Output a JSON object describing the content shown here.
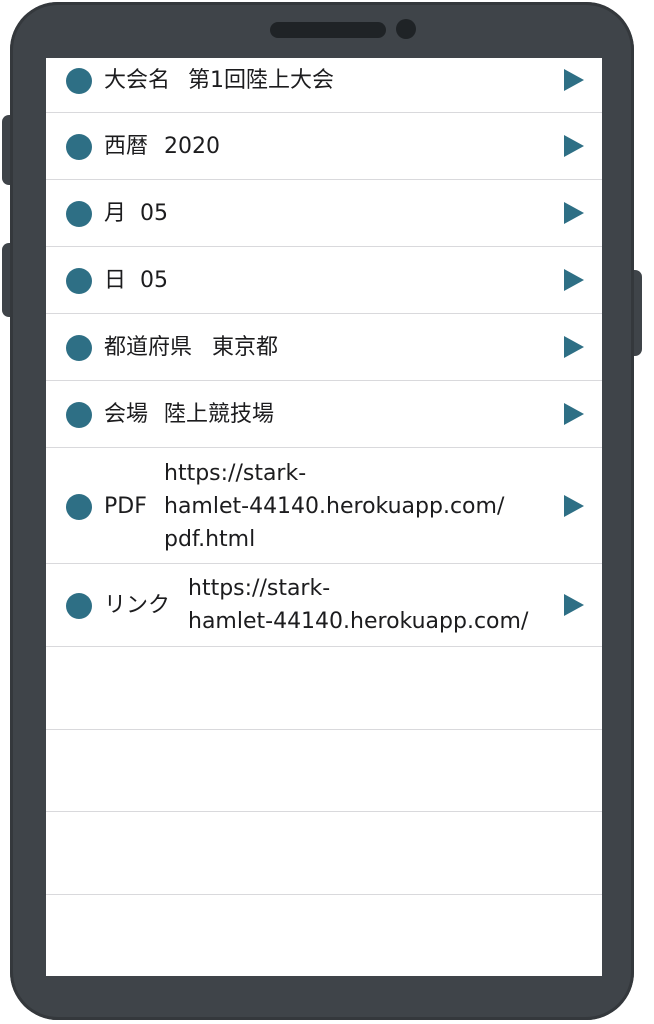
{
  "colors": {
    "accent": "#2e6f85",
    "phone_frame": "#3f4449",
    "separator": "#d9d9dc",
    "text": "#1c1c1e"
  },
  "icons": {
    "row_bullet": "filled-circle-icon",
    "row_disclosure": "play-triangle-icon"
  },
  "list": {
    "items": [
      {
        "label": "大会名",
        "value": "第1回陸上大会"
      },
      {
        "label": "西暦",
        "value": "2020"
      },
      {
        "label": "月",
        "value": "05"
      },
      {
        "label": "日",
        "value": "05"
      },
      {
        "label": "都道府県",
        "value": "東京都"
      },
      {
        "label": "会場",
        "value": "陸上競技場"
      },
      {
        "label": "PDF",
        "value": "https://stark-\nhamlet-44140.herokuapp.com/\npdf.html"
      },
      {
        "label": "リンク",
        "value": "https://stark-\nhamlet-44140.herokuapp.com/"
      }
    ]
  }
}
